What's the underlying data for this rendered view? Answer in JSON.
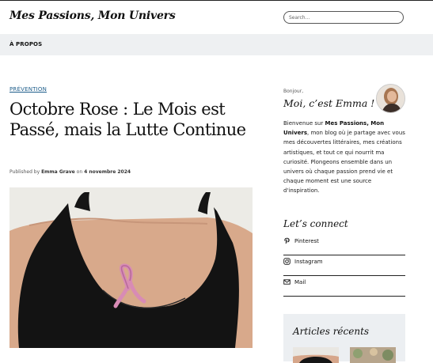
{
  "site": {
    "title": "Mes Passions, Mon Univers"
  },
  "search": {
    "placeholder": "Search..."
  },
  "nav": {
    "items": [
      {
        "label": "À PROPOS"
      }
    ]
  },
  "post": {
    "category": "PRÉVENTION",
    "title": "Octobre Rose : Le Mois est Passé, mais la Lutte Continue",
    "byline": {
      "prefix": "Published by",
      "author": "Emma Grave",
      "on": "on",
      "date": "4 novembre 2024"
    },
    "image": {
      "icon": "pink-ribbon-photo",
      "colors": {
        "top": "#111111",
        "ribbon": "#d88bb5",
        "skin": "#d9a98b"
      }
    }
  },
  "sidebar": {
    "greeting": "Bonjour,",
    "title": "Moi, c’est Emma !",
    "bio": {
      "prefix": "Bienvenue sur ",
      "site": "Mes Passions, Mon Univers",
      "text": ", mon blog où je partage avec vous mes découvertes littéraires, mes créations artistiques, et tout ce qui nourrit ma curiosité. Plongeons ensemble dans un univers où chaque passion prend vie et chaque moment est une source d'inspiration."
    },
    "connect": {
      "title": "Let’s connect",
      "links": [
        {
          "label": "Pinterest",
          "icon": "pinterest-icon"
        },
        {
          "label": "Instagram",
          "icon": "instagram-icon"
        },
        {
          "label": "Mail",
          "icon": "mail-icon"
        }
      ]
    },
    "recent": {
      "title": "Articles récents"
    }
  }
}
